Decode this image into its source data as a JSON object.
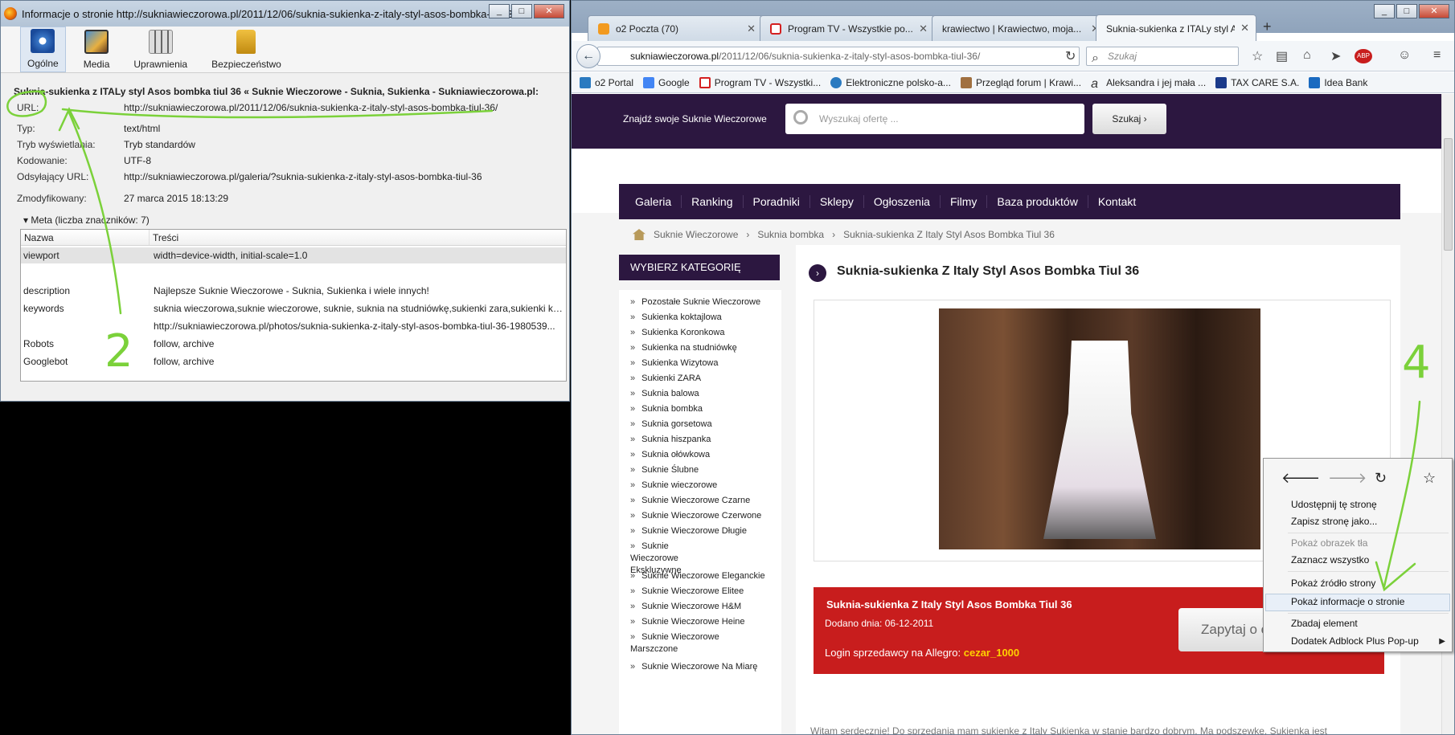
{
  "dialog": {
    "title": "Informacje o stronie http://sukniawieczorowa.pl/2011/12/06/suknia-sukienka-z-italy-styl-asos-bombka-tiul-36/",
    "window_buttons": [
      "_",
      "□",
      "✕"
    ],
    "tabs": [
      "Ogólne",
      "Media",
      "Uprawnienia",
      "Bezpieczeństwo"
    ],
    "page_title": "Suknia-sukienka z ITALy styl Asos bombka tiul 36 « Suknie Wieczorowe - Suknia, Sukienka - Sukniawieczorowa.pl:",
    "fields": [
      {
        "label": "URL:",
        "value": "http://sukniawieczorowa.pl/2011/12/06/suknia-sukienka-z-italy-styl-asos-bombka-tiul-36/"
      },
      {
        "label": "Typ:",
        "value": "text/html"
      },
      {
        "label": "Tryb wyświetlania:",
        "value": "Tryb standardów"
      },
      {
        "label": "Kodowanie:",
        "value": "UTF-8"
      },
      {
        "label": "Odsyłający URL:",
        "value": "http://sukniawieczorowa.pl/galeria/?suknia-sukienka-z-italy-styl-asos-bombka-tiul-36"
      },
      {
        "label": "Zmodyfikowany:",
        "value": "27 marca 2015 18:13:29"
      }
    ],
    "meta_header": "Meta (liczba znaczników: 7)",
    "meta_columns": [
      "Nazwa",
      "Treści"
    ],
    "meta_rows": [
      {
        "name": "viewport",
        "value": "width=device-width, initial-scale=1.0"
      },
      {
        "name": "",
        "value": ""
      },
      {
        "name": "description",
        "value": "Najlepsze Suknie Wieczorowe - Suknia, Sukienka i wiele innych!"
      },
      {
        "name": "keywords",
        "value": "suknia wieczorowa,suknie wieczorowe, suknie, suknia na studniówkę,sukienki zara,sukienki kor..."
      },
      {
        "name": "",
        "value": "http://sukniawieczorowa.pl/photos/suknia-sukienka-z-italy-styl-asos-bombka-tiul-36-1980539..."
      },
      {
        "name": "Robots",
        "value": "follow, archive"
      },
      {
        "name": "Googlebot",
        "value": "follow, archive"
      }
    ]
  },
  "browser": {
    "tabs": [
      {
        "label": "o2 Poczta (70)",
        "color": "#f29a1f"
      },
      {
        "label": "Program TV - Wszystkie po...",
        "color": "#d42020"
      },
      {
        "label": "krawiectwo | Krawiectwo, moja...",
        "color": "#cccccc"
      },
      {
        "label": "Suknia-sukienka z ITALy styl As...",
        "color": "#ffffff"
      }
    ],
    "new_tab": "+",
    "url_host": "sukniawieczorowa.pl",
    "url_path": "/2011/12/06/suknia-sukienka-z-italy-styl-asos-bombka-tiul-36/",
    "search_placeholder": "Szukaj",
    "bookmarks": [
      {
        "label": "o2 Portal",
        "color": "#2a7ac0"
      },
      {
        "label": "Google",
        "color": "#4285f4"
      },
      {
        "label": "Program TV - Wszystki...",
        "color": "#d42020"
      },
      {
        "label": "Elektroniczne polsko-a...",
        "color": "#2a7ac0"
      },
      {
        "label": "Przegląd forum | Krawi...",
        "color": "#a07040"
      },
      {
        "label": "Aleksandra i jej mała ...",
        "color": "#333333"
      },
      {
        "label": "TAX CARE S.A.",
        "color": "#1a3a8a"
      },
      {
        "label": "Idea Bank",
        "color": "#1a6ac0"
      }
    ]
  },
  "site": {
    "find_label": "Znajdź swoje Suknie Wieczorowe",
    "search_placeholder": "Wyszukaj ofertę ...",
    "search_button": "Szukaj",
    "menu": [
      "Galeria",
      "Ranking",
      "Poradniki",
      "Sklepy",
      "Ogłoszenia",
      "Filmy",
      "Baza produktów",
      "Kontakt"
    ],
    "breadcrumbs": [
      "Suknie Wieczorowe",
      "Suknia bombka",
      "Suknia-sukienka Z Italy Styl Asos Bombka Tiul 36"
    ],
    "category_header": "WYBIERZ KATEGORIĘ",
    "categories": [
      "Pozostałe Suknie Wieczorowe",
      "Sukienka koktajlowa",
      "Sukienka Koronkowa",
      "Sukienka na studniówkę",
      "Sukienka Wizytowa",
      "Sukienki ZARA",
      "Suknia balowa",
      "Suknia bombka",
      "Suknia gorsetowa",
      "Suknia hiszpanka",
      "Suknia ołówkowa",
      "Suknie Ślubne",
      "Suknie wieczorowe",
      "Suknie Wieczorowe Czarne",
      "Suknie Wieczorowe Czerwone",
      "Suknie Wieczorowe Długie",
      "Suknie Wieczorowe Ekskluzywne",
      "Suknie Wieczorowe Eleganckie",
      "Suknie Wieczorowe Elitee",
      "Suknie Wieczorowe H&M",
      "Suknie Wieczorowe Heine",
      "Suknie Wieczorowe Marszczone",
      "Suknie Wieczorowe Na Miarę"
    ],
    "product_title": "Suknia-sukienka Z Italy Styl Asos Bombka Tiul 36",
    "red_title": "Suknia-sukienka Z Italy Styl Asos Bombka Tiul 36",
    "added_label": "Dodano dnia:",
    "added_date": "06-12-2011",
    "login_label": "Login sprzedawcy na Allegro:",
    "login_value": "cezar_1000",
    "ask_button": "Zapytaj o c",
    "description": "Witam serdecznie! Do sprzedania mam sukienkę z Italy Sukienka w stanie bardzo dobrym. Ma podszewkę. Sukienka jest"
  },
  "context_menu": {
    "items": [
      {
        "label": "Udostępnij tę stronę",
        "disabled": false
      },
      {
        "label": "Zapisz stronę jako...",
        "disabled": false
      },
      {
        "label": "Pokaż obrazek tła",
        "disabled": true
      },
      {
        "label": "Zaznacz wszystko",
        "disabled": false
      },
      {
        "label": "Pokaż źródło strony",
        "disabled": false
      },
      {
        "label": "Pokaż informacje o stronie",
        "disabled": false
      },
      {
        "label": "Zbadaj element",
        "disabled": false
      },
      {
        "label": "Dodatek Adblock Plus Pop-up",
        "disabled": false
      }
    ]
  },
  "annotations": [
    "2",
    "4"
  ]
}
